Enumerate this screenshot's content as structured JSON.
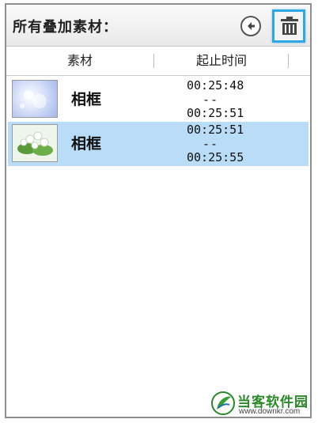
{
  "header": {
    "title": "所有叠加素材：",
    "back_icon": "circle-left-arrow-icon",
    "trash_icon": "trash-icon",
    "accent_color": "#2fa7e0"
  },
  "columns": {
    "material": "素材",
    "time": "起止时间"
  },
  "rows": [
    {
      "name": "相框",
      "start": "00:25:48",
      "separator": "--",
      "end": "00:25:51",
      "selected": false
    },
    {
      "name": "相框",
      "start": "00:25:51",
      "separator": "--",
      "end": "00:25:55",
      "selected": true
    }
  ],
  "watermark": {
    "name": "当客软件园",
    "url": "www.downkr.com"
  }
}
